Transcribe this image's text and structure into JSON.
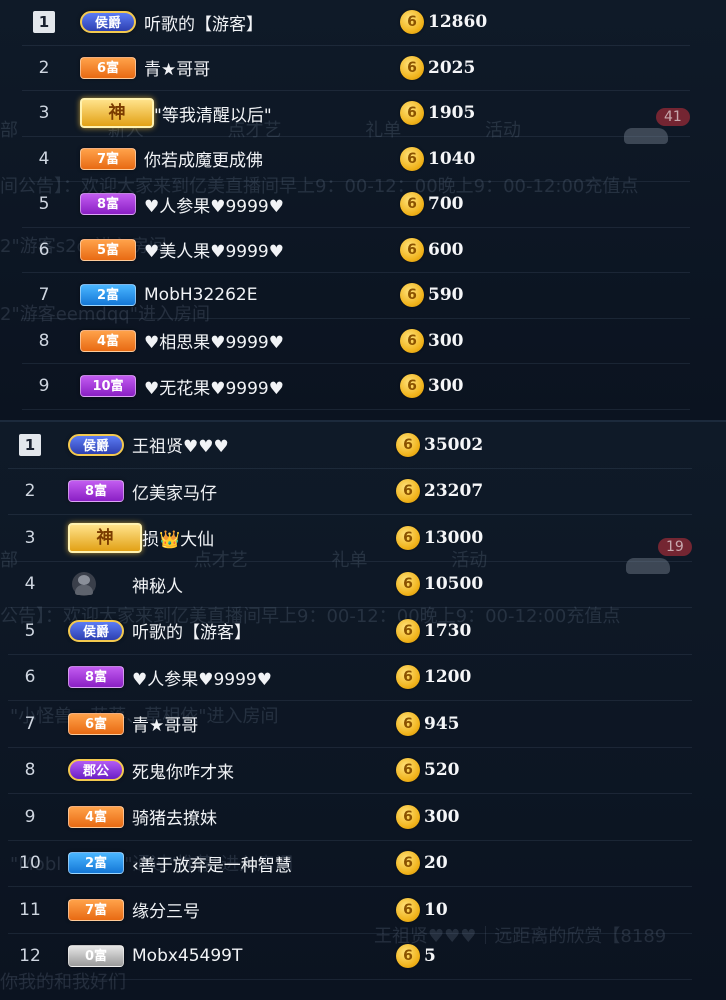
{
  "coin_glyph": "6",
  "ghost": {
    "tab_partial": "部",
    "tabs": [
      "新人",
      "点才艺",
      "礼单",
      "活动"
    ],
    "notice": "间公告】：欢迎大家来到亿美直播间早上9：00-12：00晚上9：00-12:00充值点",
    "notice2": "公告】：欢迎大家来到亿美直播间早上9：00-12：00晚上9：00-12:00充值点",
    "enter1": "2\"游客s2c\"进入房间",
    "enter2": "2\"游客eemdqq\"进入房间",
    "enter3": "\"小怪兽、花落、草相依\"进入房间",
    "enter4": "\"Mobl 51750\"通过\"推荐\"进入房间",
    "gift": "王祖贤♥♥♥｜远距离的欣赏【8189",
    "count_top": "41",
    "count_bottom": "19",
    "bottom_line": "你我的和我好们"
  },
  "top_list": [
    {
      "rank": "1",
      "badge": "侯爵",
      "badge_style": "noble",
      "name": "听歌的【游客】",
      "score": "12860"
    },
    {
      "rank": "2",
      "badge": "6富",
      "badge_style": "orange",
      "name": "青★哥哥",
      "score": "2025"
    },
    {
      "rank": "3",
      "badge": "神",
      "badge_style": "god",
      "name": "\"等我清醒以后\"",
      "score": "1905"
    },
    {
      "rank": "4",
      "badge": "7富",
      "badge_style": "orange",
      "name": "你若成魔更成佛",
      "score": "1040"
    },
    {
      "rank": "5",
      "badge": "8富",
      "badge_style": "purple",
      "name": "♥人参果♥9999♥",
      "score": "700"
    },
    {
      "rank": "6",
      "badge": "5富",
      "badge_style": "orange",
      "name": "♥美人果♥9999♥",
      "score": "600"
    },
    {
      "rank": "7",
      "badge": "2富",
      "badge_style": "blue",
      "name": "MobH32262E",
      "score": "590"
    },
    {
      "rank": "8",
      "badge": "4富",
      "badge_style": "orange",
      "name": "♥相思果♥9999♥",
      "score": "300"
    },
    {
      "rank": "9",
      "badge": "10富",
      "badge_style": "purple",
      "name": "♥无花果♥9999♥",
      "score": "300"
    }
  ],
  "bottom_list": [
    {
      "rank": "1",
      "badge": "侯爵",
      "badge_style": "noble",
      "name": "王祖贤♥♥♥",
      "score": "35002"
    },
    {
      "rank": "2",
      "badge": "8富",
      "badge_style": "purple",
      "name": "亿美家马仔",
      "score": "23207"
    },
    {
      "rank": "3",
      "badge": "神",
      "badge_style": "god",
      "name": "损👑大仙",
      "score": "13000"
    },
    {
      "rank": "4",
      "badge": "",
      "badge_style": "avatar",
      "name": "神秘人",
      "score": "10500"
    },
    {
      "rank": "5",
      "badge": "侯爵",
      "badge_style": "noble",
      "name": "听歌的【游客】",
      "score": "1730"
    },
    {
      "rank": "6",
      "badge": "8富",
      "badge_style": "purple",
      "name": "♥人参果♥9999♥",
      "score": "1200"
    },
    {
      "rank": "7",
      "badge": "6富",
      "badge_style": "orange",
      "name": "青★哥哥",
      "score": "945"
    },
    {
      "rank": "8",
      "badge": "郡公",
      "badge_style": "duke",
      "name": "死鬼你咋才来",
      "score": "520"
    },
    {
      "rank": "9",
      "badge": "4富",
      "badge_style": "orange",
      "name": "骑猪去撩妹",
      "score": "300"
    },
    {
      "rank": "10",
      "badge": "2富",
      "badge_style": "blue",
      "name": "‹善于放弃是一种智慧",
      "score": "20"
    },
    {
      "rank": "11",
      "badge": "7富",
      "badge_style": "orange",
      "name": "缘分三号",
      "score": "10"
    },
    {
      "rank": "12",
      "badge": "0富",
      "badge_style": "silver",
      "name": "Mobx45499T",
      "score": "5"
    }
  ]
}
